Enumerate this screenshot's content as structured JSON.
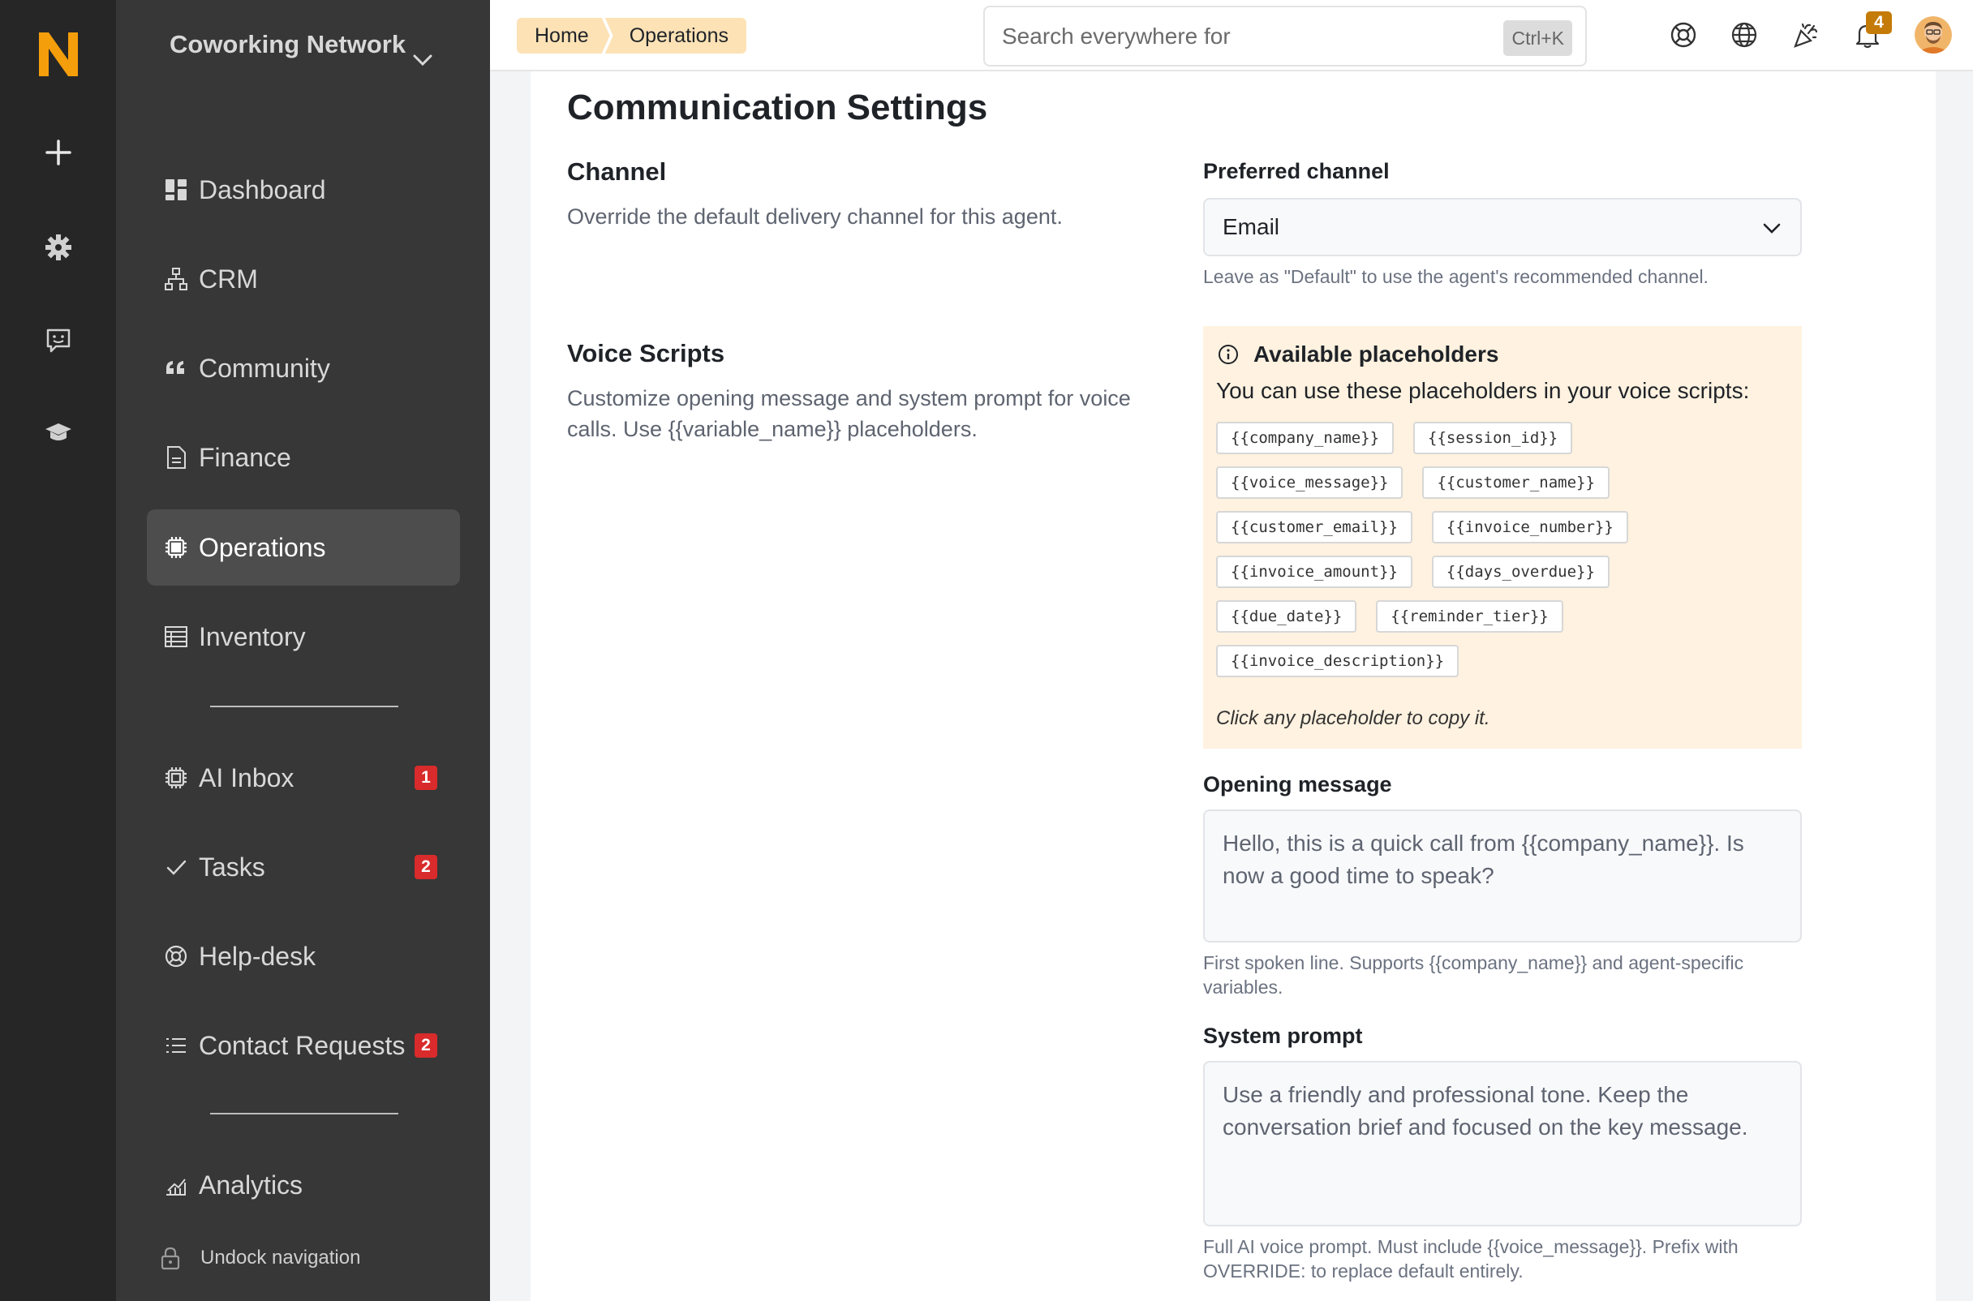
{
  "brand": {
    "logo": "N",
    "accent": "#f59e0b"
  },
  "workspace": {
    "name": "Coworking Network"
  },
  "rail": {
    "icons": [
      "plus-icon",
      "gear-icon",
      "chat-face-icon",
      "graduation-cap-icon"
    ]
  },
  "sidebar": {
    "items": [
      {
        "label": "Dashboard",
        "icon": "dashboard-icon"
      },
      {
        "label": "CRM",
        "icon": "org-chart-icon"
      },
      {
        "label": "Community",
        "icon": "quote-icon"
      },
      {
        "label": "Finance",
        "icon": "document-icon"
      },
      {
        "label": "Operations",
        "icon": "chip-icon",
        "active": true
      },
      {
        "label": "Inventory",
        "icon": "table-icon"
      },
      {
        "label": "AI Inbox",
        "icon": "chip-icon",
        "badge": "1"
      },
      {
        "label": "Tasks",
        "icon": "check-icon",
        "badge": "2"
      },
      {
        "label": "Help-desk",
        "icon": "lifebuoy-icon"
      },
      {
        "label": "Contact Requests",
        "icon": "list-icon",
        "badge": "2"
      },
      {
        "label": "Analytics",
        "icon": "chart-icon"
      }
    ],
    "undock_label": "Undock navigation"
  },
  "breadcrumbs": [
    "Home",
    "Operations"
  ],
  "search": {
    "placeholder": "Search everywhere for",
    "shortcut": "Ctrl+K"
  },
  "topbar": {
    "notification_count": "4",
    "icons": [
      "lifebuoy-icon",
      "globe-icon",
      "party-popper-icon",
      "bell-icon",
      "avatar"
    ]
  },
  "page": {
    "title": "Communication Settings",
    "channel": {
      "title": "Channel",
      "description": "Override the default delivery channel for this agent.",
      "field_label": "Preferred channel",
      "selected": "Email",
      "hint": "Leave as \"Default\" to use the agent's recommended channel."
    },
    "voice": {
      "title": "Voice Scripts",
      "description": "Customize opening message and system prompt for voice calls. Use {{variable_name}} placeholders.",
      "placeholders_title": "Available placeholders",
      "placeholders_sub": "You can use these placeholders in your voice scripts:",
      "placeholders": [
        "{{company_name}}",
        "{{session_id}}",
        "{{voice_message}}",
        "{{customer_name}}",
        "{{customer_email}}",
        "{{invoice_number}}",
        "{{invoice_amount}}",
        "{{days_overdue}}",
        "{{due_date}}",
        "{{reminder_tier}}",
        "{{invoice_description}}"
      ],
      "placeholders_foot": "Click any placeholder to copy it.",
      "opening_label": "Opening message",
      "opening_value": "Hello, this is a quick call from {{company_name}}. Is now a good time to speak?",
      "opening_hint": "First spoken line. Supports {{company_name}} and agent-specific variables.",
      "prompt_label": "System prompt",
      "prompt_value": "Use a friendly and professional tone. Keep the conversation brief and focused on the key message.",
      "prompt_hint": "Full AI voice prompt. Must include {{voice_message}}. Prefix with OVERRIDE: to replace default entirely."
    }
  }
}
